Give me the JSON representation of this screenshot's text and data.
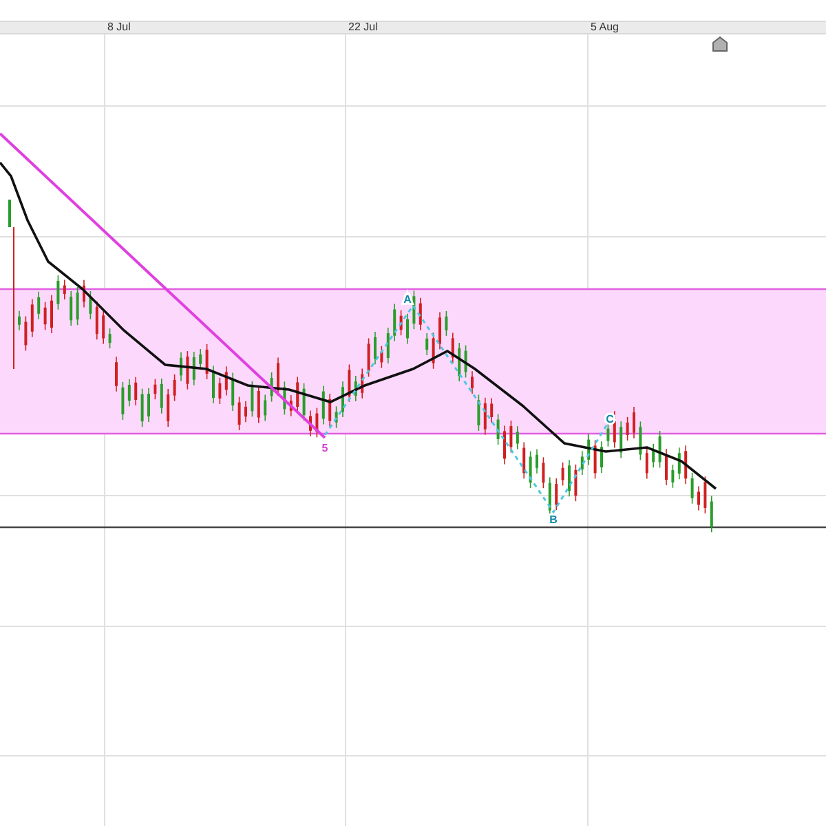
{
  "time_axis": {
    "labels": [
      "8 Jul",
      "22 Jul",
      "5 Aug"
    ]
  },
  "chart": {
    "pattern_labels": [
      {
        "text": "5",
        "color": "#d43fd4"
      },
      {
        "text": "A",
        "color": "#1189aa"
      },
      {
        "text": "B",
        "color": "#1189aa"
      },
      {
        "text": "C",
        "color": "#1189aa"
      }
    ]
  }
}
